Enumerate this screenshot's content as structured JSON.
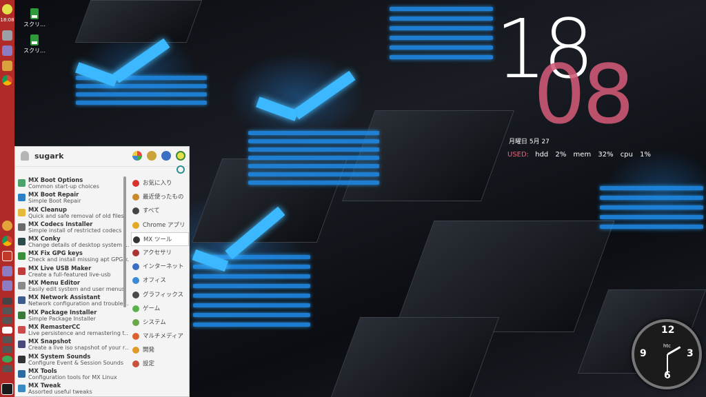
{
  "desktop": {
    "icons": [
      {
        "label": "スクリ…",
        "icon": "package-icon"
      },
      {
        "label": "スクリ…",
        "icon": "package-icon"
      }
    ]
  },
  "panel": {
    "time": "18:08",
    "color": "#b02a27",
    "app_icons": [
      "power-icon",
      "pencil-icon",
      "document-icon",
      "folder-icon",
      "chrome-icon"
    ],
    "dock_icons": [
      "files-icon",
      "chrome-icon",
      "filezilla-icon",
      "document-icon"
    ],
    "tray_icons": [
      "terminal-icon",
      "bluetooth-icon",
      "network-icon",
      "flag-icon",
      "arrow-down-icon",
      "volume-icon",
      "updater-icon",
      "eject-icon"
    ],
    "menu_button_icon": "mx-logo-icon"
  },
  "conky": {
    "hour": "18",
    "minute": "08",
    "date": "月曜日 5月 27",
    "used_label": "USED:",
    "hdd_label": "hdd",
    "hdd_value": "2%",
    "mem_label": "mem",
    "mem_value": "32%",
    "cpu_label": "cpu",
    "cpu_value": "1%",
    "accent": "#d25a78"
  },
  "analog_clock": {
    "numbers": [
      "12",
      "3",
      "6",
      "9"
    ],
    "brand": "htc"
  },
  "menu": {
    "user": "sugark",
    "header_buttons": [
      "settings-icon",
      "lock-icon",
      "logout-icon",
      "power-icon"
    ],
    "search_placeholder": "",
    "apps": [
      {
        "name": "MX Boot Options",
        "desc": "Common start-up choices",
        "color": "#4aa36a"
      },
      {
        "name": "MX Boot Repair",
        "desc": "Simple Boot Repair",
        "color": "#2f7fc4"
      },
      {
        "name": "MX Cleanup",
        "desc": "Quick and safe removal of old files",
        "color": "#e7b93a"
      },
      {
        "name": "MX Codecs Installer",
        "desc": "Simple install of restricted codecs",
        "color": "#6a6a6a"
      },
      {
        "name": "MX Conky",
        "desc": "Change details of desktop system …",
        "color": "#2d4a4a"
      },
      {
        "name": "MX Fix GPG keys",
        "desc": "Check and install missing apt GPG k…",
        "color": "#3a8f3a"
      },
      {
        "name": "MX Live USB Maker",
        "desc": "Create a full-featured live-usb",
        "color": "#c23b3b"
      },
      {
        "name": "MX Menu Editor",
        "desc": "Easily edit system and user menus",
        "color": "#8a8a8a"
      },
      {
        "name": "MX Network Assistant",
        "desc": "Network configuration and trouble…",
        "color": "#3d5b8c"
      },
      {
        "name": "MX Package Installer",
        "desc": "Simple Package Installer",
        "color": "#3a7a3a"
      },
      {
        "name": "MX RemasterCC",
        "desc": "Live persistence and remastering t…",
        "color": "#cc4a4a"
      },
      {
        "name": "MX Snapshot",
        "desc": "Create a live iso snapshot of your r…",
        "color": "#4a4a7a"
      },
      {
        "name": "MX System Sounds",
        "desc": "Configure Event & Session Sounds",
        "color": "#333333"
      },
      {
        "name": "MX Tools",
        "desc": "Configuration tools for MX Linux",
        "color": "#2d6aa0"
      },
      {
        "name": "MX Tweak",
        "desc": "Assorted useful tweaks",
        "color": "#3a8ac4"
      }
    ],
    "categories": [
      {
        "label": "お気に入り",
        "color": "#d9322e"
      },
      {
        "label": "最近使ったもの",
        "color": "#c88a2a"
      },
      {
        "label": "すべて",
        "color": "#444444"
      },
      {
        "label": "Chrome アプリ",
        "color": "#e5a823"
      },
      {
        "label": "MX ツール",
        "color": "#333333"
      },
      {
        "label": "アクセサリ",
        "color": "#a33"
      },
      {
        "label": "インターネット",
        "color": "#3b6fc4"
      },
      {
        "label": "オフィス",
        "color": "#3a8ad4"
      },
      {
        "label": "グラフィックス",
        "color": "#4a4a4a"
      },
      {
        "label": "ゲーム",
        "color": "#5ab04a"
      },
      {
        "label": "システム",
        "color": "#6aa84a"
      },
      {
        "label": "マルチメディア",
        "color": "#d9632e"
      },
      {
        "label": "開発",
        "color": "#e09a2a"
      },
      {
        "label": "設定",
        "color": "#c9533a"
      }
    ],
    "selected_category": 4
  }
}
